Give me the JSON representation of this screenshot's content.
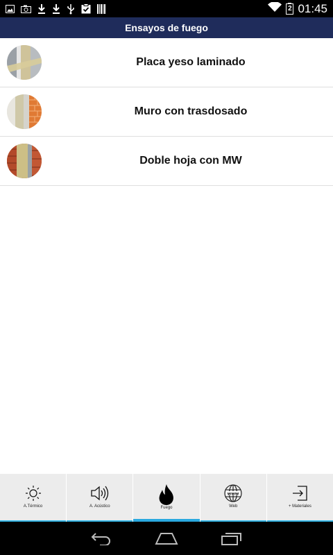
{
  "status_bar": {
    "time": "01:45",
    "battery_level": "2",
    "icons": [
      "image-icon",
      "camera-icon",
      "download-icon",
      "download-icon",
      "usb-icon",
      "clipboard-check-icon",
      "barcode-icon",
      "wifi-icon",
      "battery-icon"
    ]
  },
  "header": {
    "title": "Ensayos de fuego"
  },
  "list": {
    "items": [
      {
        "label": "Placa yeso laminado",
        "thumb": "drywall-thumbnail"
      },
      {
        "label": "Muro con trasdosado",
        "thumb": "brick-wall-lining-thumbnail"
      },
      {
        "label": "Doble hoja con MW",
        "thumb": "double-leaf-wall-thumbnail"
      }
    ]
  },
  "tabs": [
    {
      "label": "A.Térmico",
      "icon": "sun-icon",
      "active": false
    },
    {
      "label": "A. Acústico",
      "icon": "speaker-icon",
      "active": false
    },
    {
      "label": "Fuego",
      "icon": "fire-icon",
      "active": true
    },
    {
      "label": "Web",
      "icon": "globe-www-icon",
      "active": false
    },
    {
      "label": "+ Materiales",
      "icon": "enter-icon",
      "active": false
    }
  ],
  "colors": {
    "header_bg": "#1f2c5b",
    "tab_accent": "#2aa9df",
    "tabbar_bg": "#ececec"
  }
}
